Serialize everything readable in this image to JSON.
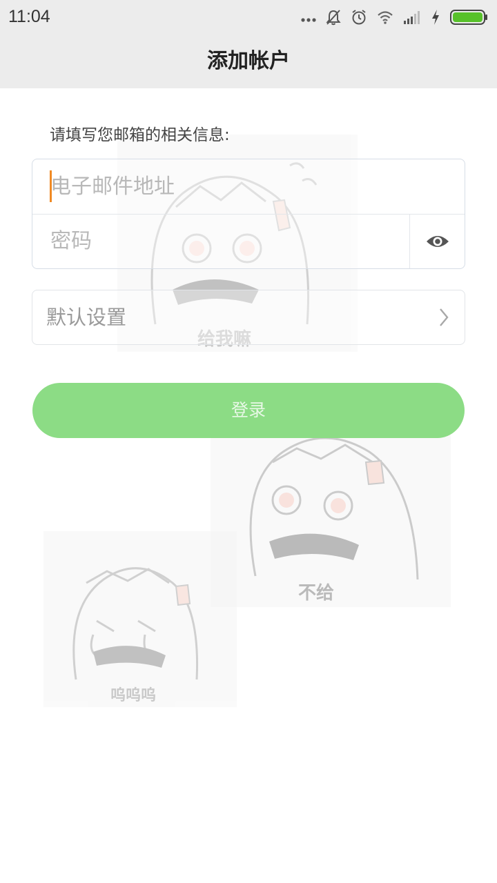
{
  "status_bar": {
    "time": "11:04",
    "icons": [
      "more-dots-icon",
      "bell-muted-icon",
      "alarm-icon",
      "wifi-icon",
      "signal-icon",
      "charging-icon",
      "battery-icon"
    ],
    "battery_color": "#57c12a"
  },
  "header": {
    "title": "添加帐户"
  },
  "form": {
    "instruction": "请填写您邮箱的相关信息:",
    "email_placeholder": "电子邮件地址",
    "password_placeholder": "密码",
    "settings_label": "默认设置",
    "login_label": "登录"
  },
  "stickers": [
    {
      "caption": "给我嘛"
    },
    {
      "caption": "不给"
    },
    {
      "caption": "呜呜呜"
    }
  ],
  "colors": {
    "login_button": "#8cdc85",
    "caret": "#f08a24",
    "header_bg": "#ececec"
  }
}
